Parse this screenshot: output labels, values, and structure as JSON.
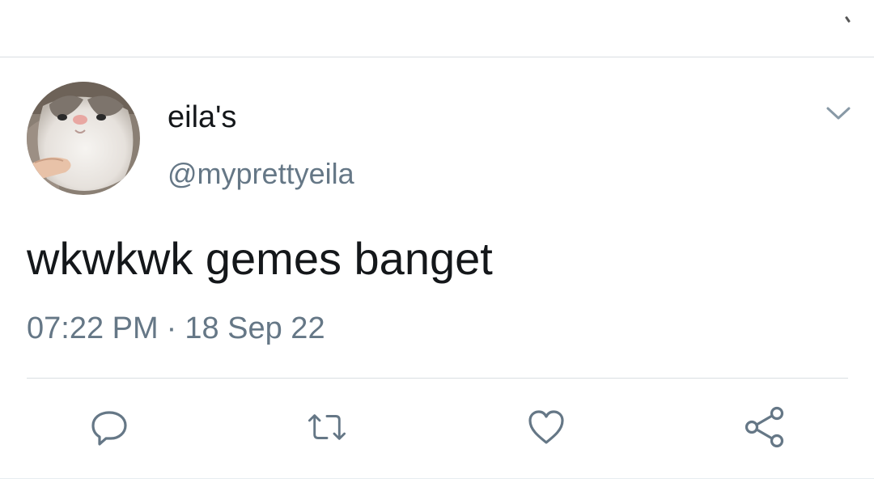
{
  "tweet": {
    "display_name": "eila's",
    "handle": "@myprettyeila",
    "text": "wkwkwk gemes banget",
    "time": "07:22 PM",
    "separator": "·",
    "date": "18 Sep 22"
  },
  "icons": {
    "more": "chevron-down-icon",
    "reply": "reply-icon",
    "retweet": "retweet-icon",
    "like": "heart-icon",
    "share": "share-icon"
  },
  "colors": {
    "text_primary": "#14171a",
    "text_secondary": "#657786",
    "icon": "#657786",
    "divider": "#d9dee2"
  }
}
